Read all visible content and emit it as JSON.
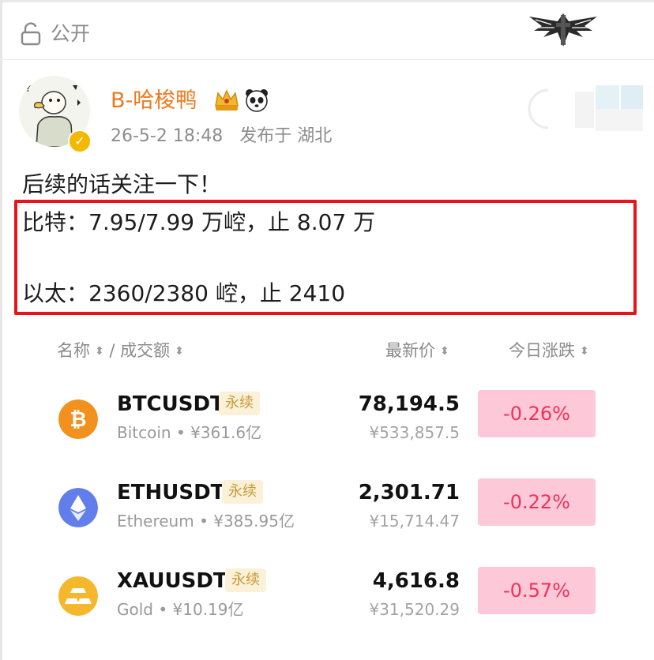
{
  "header": {
    "visibility_label": "公开"
  },
  "author": {
    "name": "B-哈梭鸭",
    "time": "26-5-2 18:48",
    "location": "发布于 湖北",
    "badge": "✓"
  },
  "post": {
    "line1": "后续的话关注一下！",
    "line2": "比特：7.95/7.99 万崆，止 8.07 万",
    "line3": "以太：2360/2380 崆，止 2410",
    "highlight_color": "#e8141b"
  },
  "market": {
    "headers": {
      "name": "名称",
      "sep": " / ",
      "volume": "成交额",
      "price": "最新价",
      "change": "今日涨跌",
      "sort_glyph": "⬍"
    },
    "rows": [
      {
        "symbol": "BTCUSDT",
        "tag": "永续",
        "name": "Bitcoin",
        "volume": "¥361.6亿",
        "price": "78,194.5",
        "price_cny": "¥533,857.5",
        "change": "-0.26%",
        "icon": "bitcoin-icon",
        "icon_color": "#f3911f"
      },
      {
        "symbol": "ETHUSDT",
        "tag": "永续",
        "name": "Ethereum",
        "volume": "¥385.95亿",
        "price": "2,301.71",
        "price_cny": "¥15,714.47",
        "change": "-0.22%",
        "icon": "ethereum-icon",
        "icon_color": "#627eea"
      },
      {
        "symbol": "XAUUSDT",
        "tag": "永续",
        "name": "Gold",
        "volume": "¥10.19亿",
        "price": "4,616.8",
        "price_cny": "¥31,520.29",
        "change": "-0.57%",
        "icon": "gold-icon",
        "icon_color": "#f5b72b"
      }
    ],
    "colors": {
      "negative_bg": "#fdc9d8",
      "negative_text": "#f0325a",
      "tag_bg": "#fbf1d8",
      "tag_text": "#c79a3b"
    }
  }
}
